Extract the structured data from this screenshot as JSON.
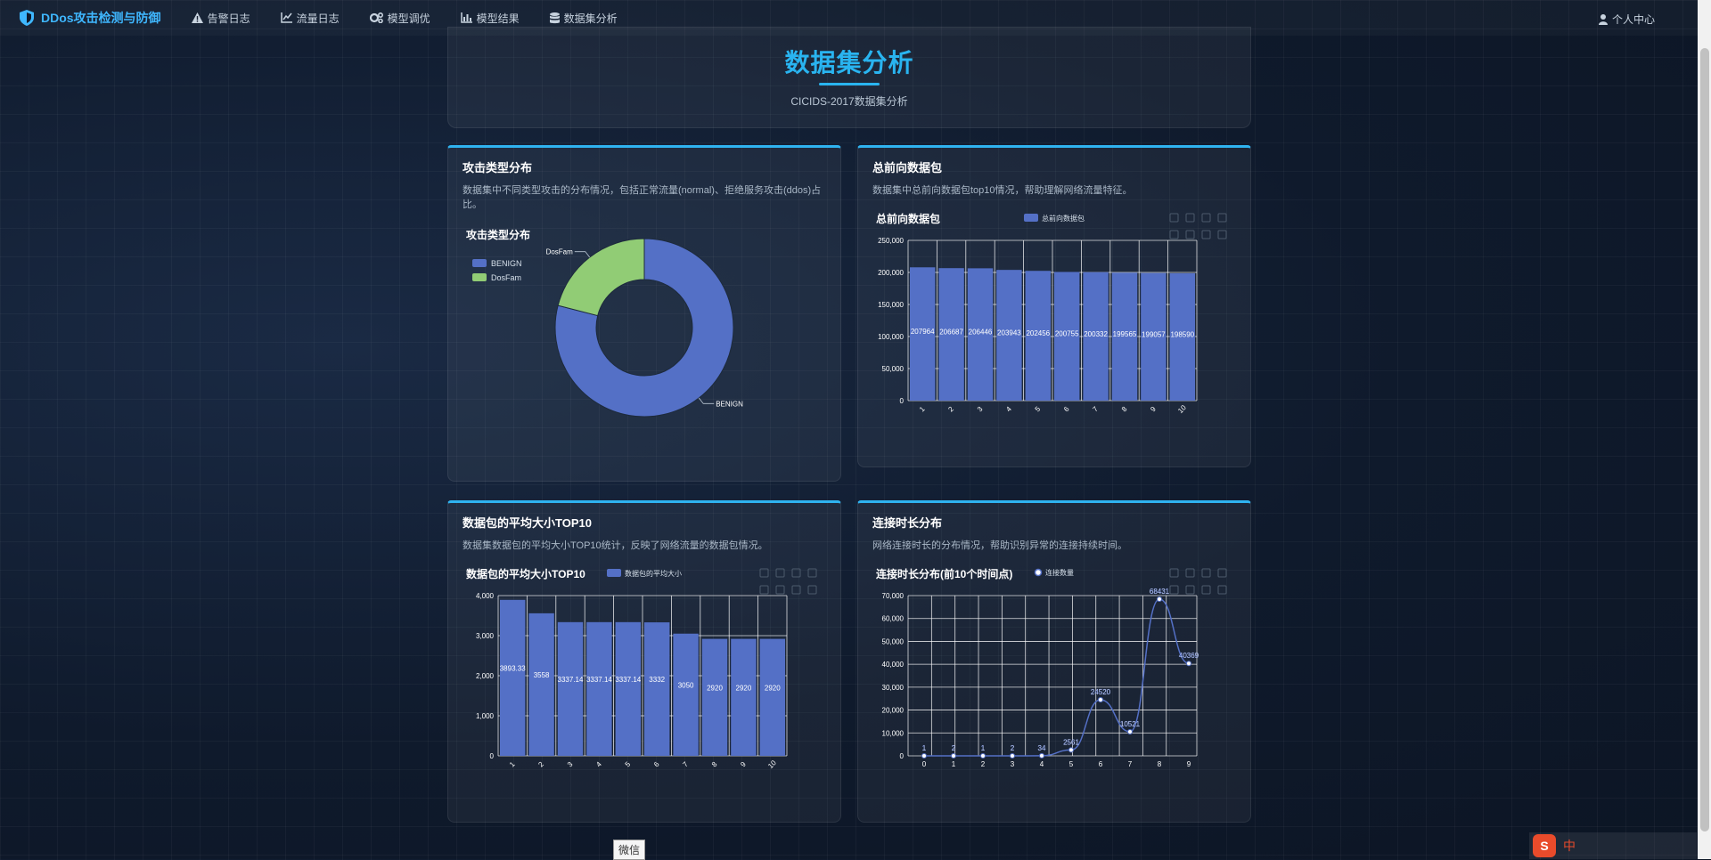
{
  "nav": {
    "brand": "DDos攻击检测与防御",
    "items": [
      {
        "label": "告警日志",
        "icon": "warning-icon"
      },
      {
        "label": "流量日志",
        "icon": "line-chart-icon"
      },
      {
        "label": "模型调优",
        "icon": "gears-icon"
      },
      {
        "label": "模型结果",
        "icon": "bar-chart-icon"
      },
      {
        "label": "数据集分析",
        "icon": "database-icon"
      }
    ],
    "user": "个人中心"
  },
  "header": {
    "title": "数据集分析",
    "subtitle": "CICIDS-2017数据集分析"
  },
  "cards": {
    "attack": {
      "title": "攻击类型分布",
      "desc": "数据集中不同类型攻击的分布情况，包括正常流量(normal)、拒绝服务攻击(ddos)占比。"
    },
    "forward": {
      "title": "总前向数据包",
      "desc": "数据集中总前向数据包top10情况，帮助理解网络流量特征。"
    },
    "avgsize": {
      "title": "数据包的平均大小TOP10",
      "desc": "数据集数据包的平均大小TOP10统计，反映了网络流量的数据包情况。"
    },
    "duration": {
      "title": "连接时长分布",
      "desc": "网络连接时长的分布情况，帮助识别异常的连接持续时间。"
    }
  },
  "wechat_tip": "微信",
  "ime": {
    "lang": "中"
  },
  "colors": {
    "accent": "#29b4f0",
    "bar": "#5470c6",
    "green": "#91cc75"
  },
  "chart_data": [
    {
      "type": "pie",
      "title": "攻击类型分布",
      "donut": true,
      "categories": [
        "BENIGN",
        "DosFam"
      ],
      "values": [
        79,
        21
      ],
      "legend_position": "top-left"
    },
    {
      "type": "bar",
      "title": "总前向数据包",
      "series": [
        {
          "name": "总前向数据包",
          "values": [
            207964,
            206687,
            206446,
            203943,
            202456,
            200755,
            200332,
            199565,
            199057,
            198590
          ]
        }
      ],
      "categories": [
        "1",
        "2",
        "3",
        "4",
        "5",
        "6",
        "7",
        "8",
        "9",
        "10"
      ],
      "ylim": [
        0,
        250000
      ],
      "yticks": [
        0,
        50000,
        100000,
        150000,
        200000,
        250000
      ],
      "ytick_labels": [
        "0",
        "50,000",
        "100,000",
        "150,000",
        "200,000",
        "250,000"
      ],
      "data_labels": [
        "207964",
        "206687",
        "206446",
        "203943",
        "202456",
        "200755",
        "200332",
        "199565",
        "199057",
        "198590"
      ],
      "grid": true
    },
    {
      "type": "bar",
      "title": "数据包的平均大小TOP10",
      "series": [
        {
          "name": "数据包的平均大小",
          "values": [
            3893.33,
            3558,
            3337.14,
            3337.14,
            3337.14,
            3332,
            3050,
            2920,
            2920,
            2920
          ]
        }
      ],
      "categories": [
        "1",
        "2",
        "3",
        "4",
        "5",
        "6",
        "7",
        "8",
        "9",
        "10"
      ],
      "ylim": [
        0,
        4000
      ],
      "yticks": [
        0,
        1000,
        2000,
        3000,
        4000
      ],
      "ytick_labels": [
        "0",
        "1,000",
        "2,000",
        "3,000",
        "4,000"
      ],
      "data_labels": [
        "3893.33",
        "3558",
        "3337.14",
        "3337.14",
        "3337.14",
        "3332",
        "3050",
        "2920",
        "2920",
        "2920"
      ],
      "grid": true
    },
    {
      "type": "line",
      "title": "连接时长分布(前10个时间点)",
      "series": [
        {
          "name": "连接数量",
          "values": [
            1,
            2,
            1,
            2,
            34,
            2561,
            24520,
            10521,
            68431,
            40369
          ]
        }
      ],
      "categories": [
        "0",
        "1",
        "2",
        "3",
        "4",
        "5",
        "6",
        "7",
        "8",
        "9"
      ],
      "ylim": [
        0,
        70000
      ],
      "yticks": [
        0,
        10000,
        20000,
        30000,
        40000,
        50000,
        60000,
        70000
      ],
      "ytick_labels": [
        "0",
        "10,000",
        "20,000",
        "30,000",
        "40,000",
        "50,000",
        "60,000",
        "70,000"
      ],
      "data_labels": [
        "1",
        "2",
        "1",
        "2",
        "34",
        "2561",
        "24520",
        "10521",
        "68431",
        "40369"
      ],
      "grid": true
    }
  ]
}
